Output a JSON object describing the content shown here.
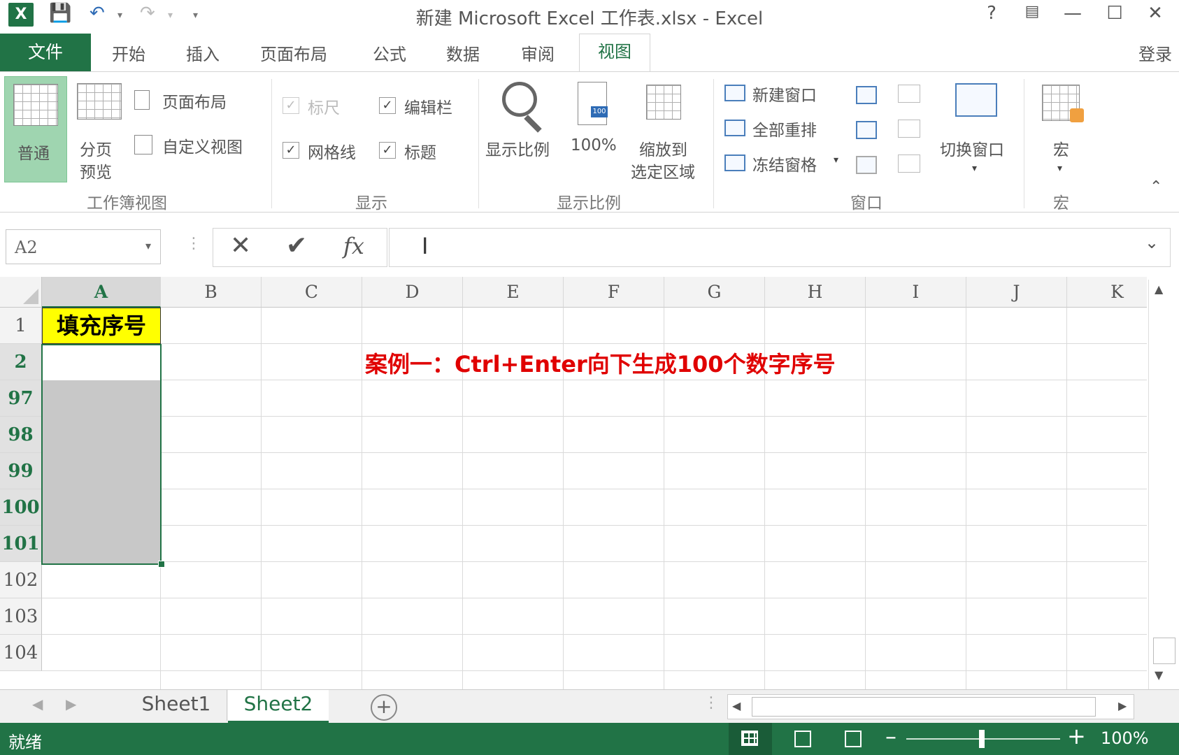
{
  "window": {
    "title": "新建 Microsoft Excel 工作表.xlsx - Excel",
    "help": "?",
    "login": "登录"
  },
  "tabs": [
    "文件",
    "开始",
    "插入",
    "页面布局",
    "公式",
    "数据",
    "审阅",
    "视图"
  ],
  "ribbon": {
    "workbook_views": {
      "normal": "普通",
      "page_break_1": "分页",
      "page_break_2": "预览",
      "page_layout": "页面布局",
      "custom_views": "自定义视图",
      "group": "工作簿视图"
    },
    "show": {
      "ruler": "标尺",
      "formula_bar": "编辑栏",
      "gridlines": "网格线",
      "headings": "标题",
      "group": "显示"
    },
    "zoom": {
      "zoom": "显示比例",
      "hundred": "100%",
      "zoom_sel_1": "缩放到",
      "zoom_sel_2": "选定区域",
      "group": "显示比例"
    },
    "window": {
      "new_window": "新建窗口",
      "arrange_all": "全部重排",
      "freeze": "冻结窗格",
      "switch": "切换窗口",
      "group": "窗口"
    },
    "macros": {
      "label": "宏",
      "group": "宏"
    }
  },
  "formula_bar": {
    "name_box": "A2",
    "fx": "fx",
    "content": ""
  },
  "columns": [
    "A",
    "B",
    "C",
    "D",
    "E",
    "F",
    "G",
    "H",
    "I",
    "J",
    "K"
  ],
  "rows": [
    "1",
    "2",
    "97",
    "98",
    "99",
    "100",
    "101",
    "102",
    "103",
    "104"
  ],
  "cells": {
    "A1": "填充序号"
  },
  "annotation": "案例一：Ctrl+Enter向下生成100个数字序号",
  "sheets": [
    "Sheet1",
    "Sheet2"
  ],
  "active_sheet": "Sheet2",
  "status": {
    "ready": "就绪",
    "zoom": "100%"
  },
  "colors": {
    "excel_green": "#217346",
    "header_fill": "#ffff00",
    "annotation": "#e00000"
  }
}
